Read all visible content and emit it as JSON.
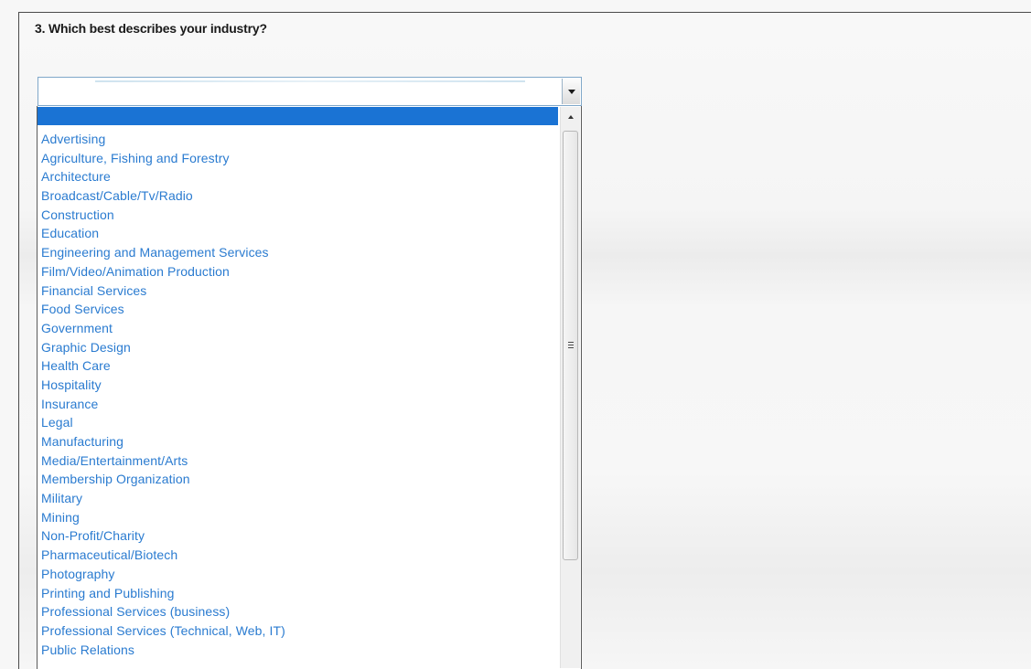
{
  "question": {
    "text": "3. Which best describes your industry?"
  },
  "select": {
    "value": "",
    "dropdown_icon": "chevron-down-icon"
  },
  "listbox": {
    "highlighted_option": "",
    "options": [
      "Advertising",
      "Agriculture, Fishing and Forestry",
      "Architecture",
      "Broadcast/Cable/Tv/Radio",
      "Construction",
      "Education",
      "Engineering and Management Services",
      "Film/Video/Animation Production",
      "Financial Services",
      "Food Services",
      "Government",
      "Graphic Design",
      "Health Care",
      "Hospitality",
      "Insurance",
      "Legal",
      "Manufacturing",
      "Media/Entertainment/Arts",
      "Membership Organization",
      "Military",
      "Mining",
      "Non-Profit/Charity",
      "Pharmaceutical/Biotech",
      "Photography",
      "Printing and Publishing",
      "Professional Services (business)",
      "Professional Services (Technical, Web, IT)",
      "Public Relations"
    ]
  },
  "colors": {
    "highlight": "#1a73d4",
    "option_text": "#2a7bd0"
  }
}
